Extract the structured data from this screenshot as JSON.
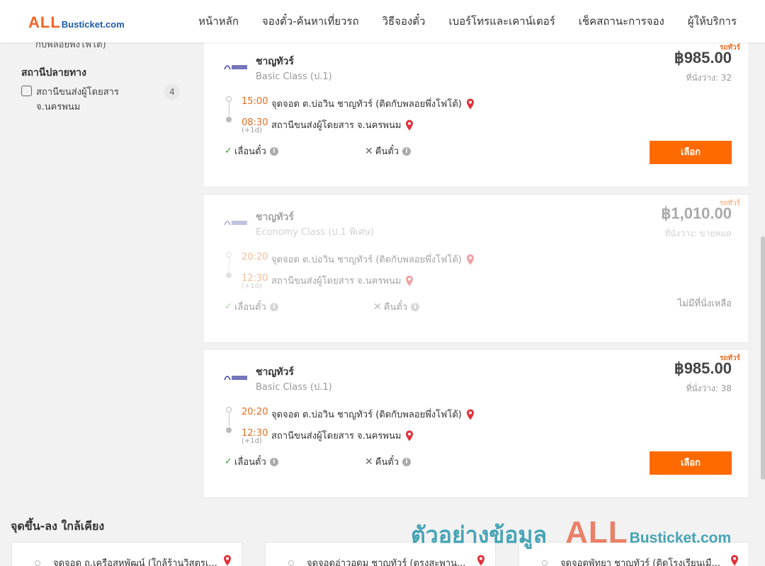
{
  "header": {
    "logo_all": "ALL",
    "logo_rest": "Busticket.com",
    "nav": [
      "หน้าหลัก",
      "จองตั๋ว-ค้นหาเที่ยวรถ",
      "วิธีจองตั๋ว",
      "เบอร์โทรและเคาน์เตอร์",
      "เช็คสถานะการจอง",
      "ผู้ให้บริการ"
    ]
  },
  "sidebar": {
    "cut_text": "กับพลอยพึ่งโฟโต้)",
    "arrival_title": "สถานีปลายทาง",
    "arrival_option_label": "สถานีขนส่งผู้โดยสาร จ.นครพนม",
    "arrival_option_count": "4"
  },
  "trips": [
    {
      "tag": "รถทัวร์",
      "operator": "ชาญทัวร์",
      "bus_class": "Basic Class (ป.1)",
      "price": "฿985.00",
      "seats": "ที่นั่งว่าง: 32",
      "depart_time": "15:00",
      "depart_stop": "จุดจอด ต.บ่อวิน ชาญทัวร์ (ติดกับพลอยพึ่งโฟโต้)",
      "arrive_time": "08:30",
      "arrive_stop": "สถานีขนส่งผู้โดยสาร จ.นครพนม",
      "next_day": "(+1d)",
      "feature_change": "เลื่อนตั๋ว",
      "feature_refund": "คืนตั๋ว",
      "select_label": "เลือก"
    },
    {
      "tag": "รถทัวร์",
      "operator": "ชาญทัวร์",
      "bus_class": "Economy Class (ป.1 พิเศษ)",
      "price": "฿1,010.00",
      "seats": "ที่นั่งว่าง: ขายหมด",
      "depart_time": "20:20",
      "depart_stop": "จุดจอด ต.บ่อวิน ชาญทัวร์ (ติดกับพลอยพึ่งโฟโต้)",
      "arrive_time": "12:30",
      "arrive_stop": "สถานีขนส่งผู้โดยสาร จ.นครพนม",
      "next_day": "(+1d)",
      "feature_change": "เลื่อนตั๋ว",
      "feature_refund": "คืนตั๋ว",
      "soldout_label": "ไม่มีที่นั่งเหลือ"
    },
    {
      "tag": "รถทัวร์",
      "operator": "ชาญทัวร์",
      "bus_class": "Basic Class (ป.1)",
      "price": "฿985.00",
      "seats": "ที่นั่งว่าง: 38",
      "depart_time": "20:20",
      "depart_stop": "จุดจอด ต.บ่อวิน ชาญทัวร์ (ติดกับพลอยพึ่งโฟโต้)",
      "arrive_time": "12:30",
      "arrive_stop": "สถานีขนส่งผู้โดยสาร จ.นครพนม",
      "next_day": "(+1d)",
      "feature_change": "เลื่อนตั๋ว",
      "feature_refund": "คืนตั๋ว",
      "select_label": "เลือก"
    }
  ],
  "nearby": {
    "title": "จุดขึ้น-ลง ใกล้เคียง",
    "items": [
      "จุดจอด ถ.เครือสหพัฒน์ (ใกล้ร้านวิสูตรเ...",
      "จุดจอดอ่าวอุดม ชาญทัวร์ (ตรงสะพาน...",
      "จุดจอดพัทยา ชาญทัวร์ (ติดโรงเรียนเมื..."
    ]
  },
  "watermark": {
    "text": "ตัวอย่างข้อมูล",
    "logo_all": "ALL",
    "logo_rest": "Busticket.com"
  },
  "colors": {
    "accent": "#ff6a00",
    "time": "#e56c1f",
    "brand_blue": "#1e5aa8"
  }
}
